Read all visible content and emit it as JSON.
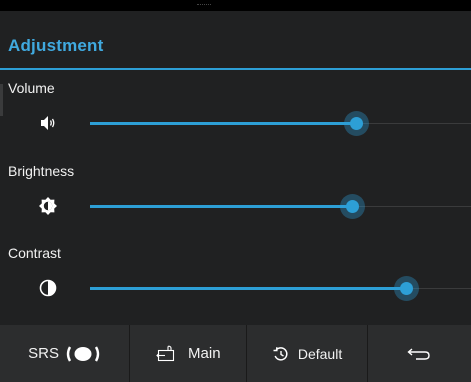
{
  "header": {
    "title": "Adjustment"
  },
  "sliders": [
    {
      "id": "volume",
      "label": "Volume",
      "icon": "speaker-icon",
      "value_fraction": 0.7
    },
    {
      "id": "brightness",
      "label": "Brightness",
      "icon": "brightness-icon",
      "value_fraction": 0.69
    },
    {
      "id": "contrast",
      "label": "Contrast",
      "icon": "contrast-icon",
      "value_fraction": 0.83
    }
  ],
  "toolbar": {
    "srs_label": "SRS",
    "srs_icon": "srs-toggle-icon",
    "main_label": "Main",
    "main_icon": "input-source-icon",
    "default_label": "Default",
    "default_icon": "reset-icon",
    "back_icon": "back-arrow-icon"
  },
  "colors": {
    "accent": "#2d9fd6",
    "title": "#40a9df",
    "background": "#202122",
    "toolbar": "#2c2d2e"
  }
}
